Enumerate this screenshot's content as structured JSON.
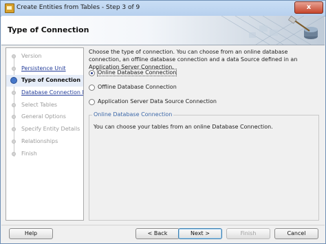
{
  "window": {
    "title": "Create Entities from Tables - Step 3 of 9",
    "close_label": "x"
  },
  "header": {
    "heading": "Type of Connection"
  },
  "nav": {
    "items": [
      {
        "label": "Version",
        "state": "disabled"
      },
      {
        "label": "Persistence Unit",
        "state": "link"
      },
      {
        "label": "Type of Connection",
        "state": "current"
      },
      {
        "label": "Database Connection De",
        "state": "link"
      },
      {
        "label": "Select Tables",
        "state": "disabled"
      },
      {
        "label": "General Options",
        "state": "disabled"
      },
      {
        "label": "Specify Entity Details",
        "state": "disabled"
      },
      {
        "label": "Relationships",
        "state": "disabled"
      },
      {
        "label": "Finish",
        "state": "disabled"
      }
    ]
  },
  "content": {
    "description": "Choose the type of connection. You can choose from an online database connection, an offline database connection and a data Source defined in an Application Server Connection.",
    "options": [
      {
        "label": "Online Database Connection",
        "selected": true
      },
      {
        "label": "Offline Database Connection",
        "selected": false
      },
      {
        "label": "Application Server Data Source Connection",
        "selected": false
      }
    ],
    "group": {
      "title": "Online Database Connection",
      "text": "You can choose your tables from an online Database Connection."
    }
  },
  "buttons": {
    "help": "Help",
    "back": "< Back",
    "next": "Next >",
    "finish": "Finish",
    "cancel": "Cancel"
  }
}
